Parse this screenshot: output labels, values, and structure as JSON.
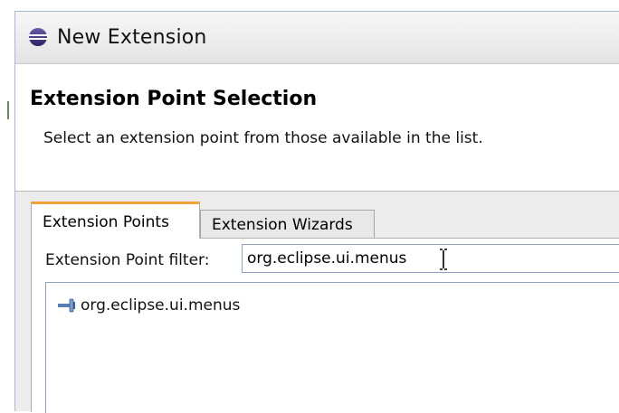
{
  "window": {
    "title": "New Extension",
    "icon": "eclipse-icon"
  },
  "header": {
    "title": "Extension Point Selection",
    "description": "Select an extension point from those available in the list."
  },
  "tabs": [
    {
      "label": "Extension Points",
      "selected": true
    },
    {
      "label": "Extension Wizards",
      "selected": false
    }
  ],
  "filter": {
    "label": "Extension Point filter:",
    "value": "org.eclipse.ui.menus"
  },
  "list": {
    "items": [
      {
        "label": "org.eclipse.ui.menus",
        "icon": "extension-point-icon"
      }
    ]
  },
  "colors": {
    "active_tab_accent": "#f2a23a",
    "panel_background": "#ececec",
    "input_border": "#8ea2bd"
  }
}
